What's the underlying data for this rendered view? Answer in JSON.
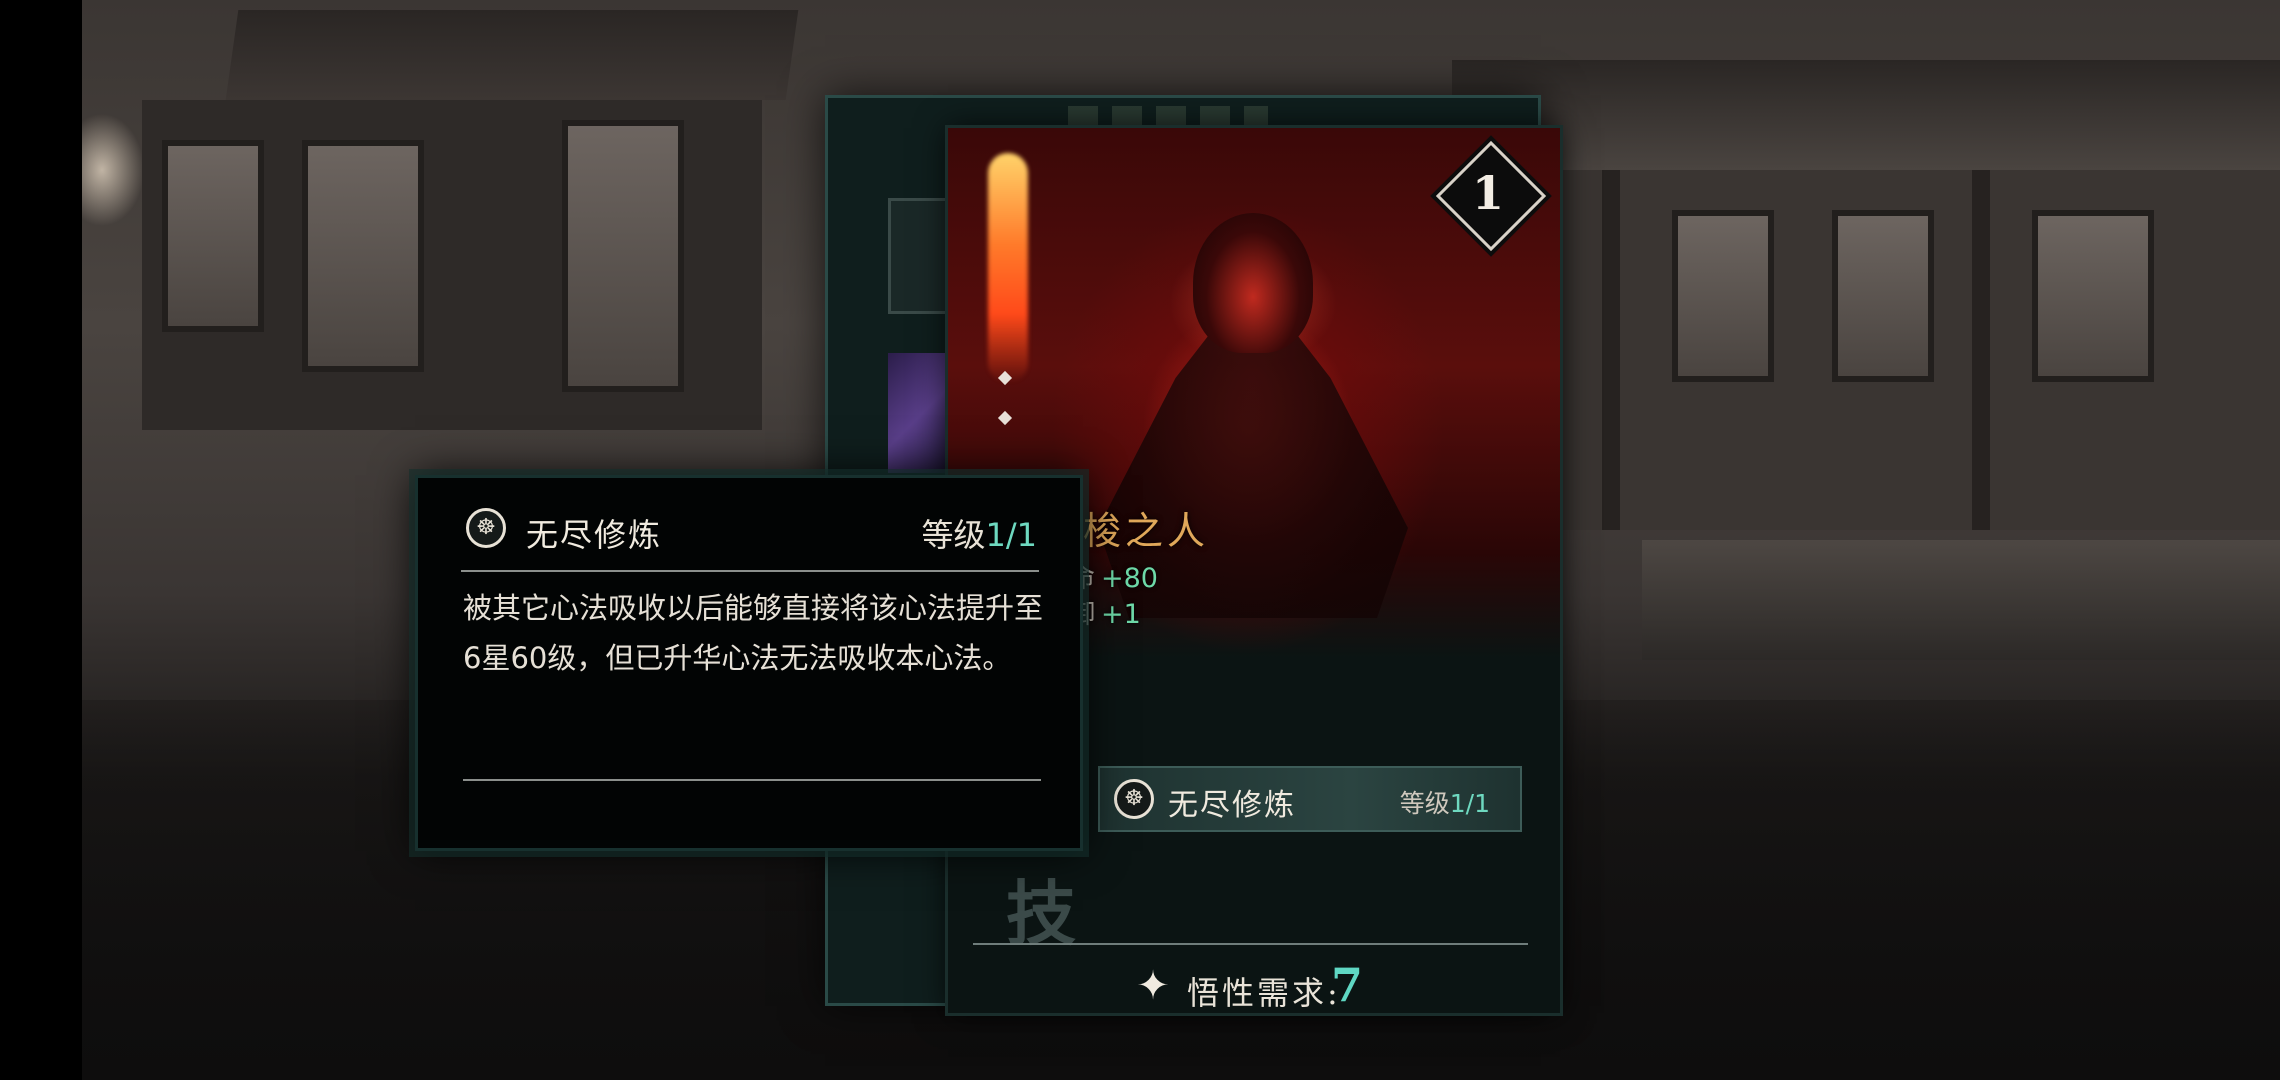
{
  "card": {
    "level": "1",
    "name_visible": "梭之人",
    "stats": [
      {
        "label": "命",
        "value": "+80"
      },
      {
        "label": "御",
        "value": "+1"
      }
    ],
    "faded_char": "技",
    "skill": {
      "icon": "meditating-figure-icon",
      "name": "无尽修炼",
      "level_label": "等级",
      "level_value": "1/1"
    },
    "requirement": {
      "icon": "comprehension-star-icon",
      "label": "悟性需求:",
      "value": "7"
    }
  },
  "tooltip": {
    "icon": "meditating-figure-icon",
    "name": "无尽修炼",
    "level_label": "等级",
    "level_value": "1/1",
    "description": "被其它心法吸收以后能够直接将该心法提升至6星60级，但已升华心法无法吸收本心法。"
  },
  "colors": {
    "accent_teal": "#6ed9c0",
    "stat_green": "#6ed9a8",
    "name_gold": "#e0a85a"
  }
}
